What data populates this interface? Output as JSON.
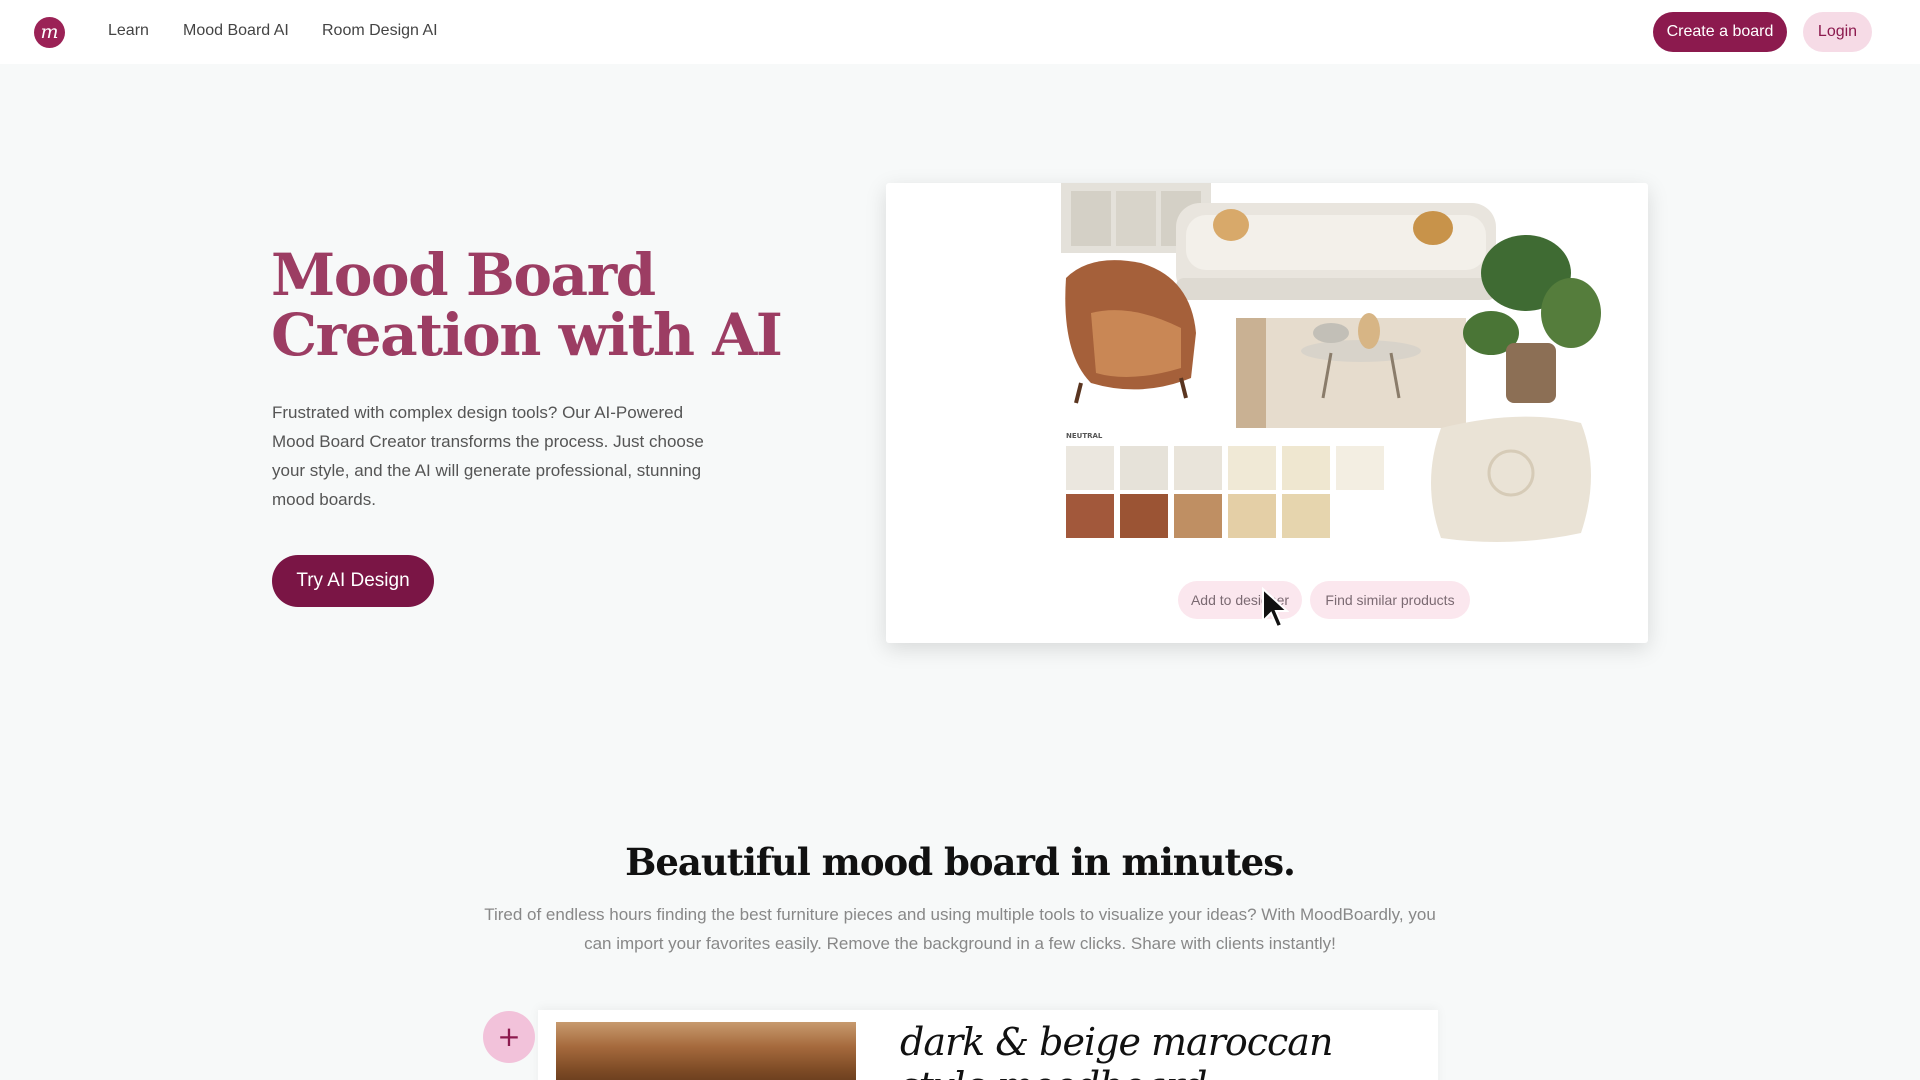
{
  "nav": {
    "logo_glyph": "m",
    "links": [
      "Learn",
      "Mood Board AI",
      "Room Design AI"
    ],
    "create_label": "Create a board",
    "login_label": "Login"
  },
  "hero": {
    "title": "Mood Board Creation with AI",
    "description": "Frustrated with complex design tools? Our AI-Powered Mood Board Creator transforms the process. Just choose your style, and the AI will generate professional, stunning mood boards.",
    "cta_label": "Try AI Design"
  },
  "preview": {
    "actions": [
      "Add to designer",
      "Find similar products"
    ],
    "swatch_colors": [
      "#ebe7df",
      "#e6e2d9",
      "#e9e4da",
      "#f0e9d6",
      "#efe7d0",
      "#f3eee2",
      "#a2583b",
      "#9b5434",
      "#bf8f63",
      "#e4cfa6",
      "#e6d5ae"
    ]
  },
  "section": {
    "title": "Beautiful mood board in minutes.",
    "description": "Tired of endless hours finding the best furniture pieces and using multiple tools to visualize your ideas? With MoodBoardly, you can import your favorites easily. Remove the background in a few clicks. Share with clients instantly!"
  },
  "bottom_preview": {
    "plus_glyph": "+",
    "script_title": "dark & beige maroccan style moodboard"
  },
  "colors": {
    "brand": "#8c1a4e",
    "brand_light": "#f6dbe6",
    "hero_title": "#9c3d63"
  }
}
